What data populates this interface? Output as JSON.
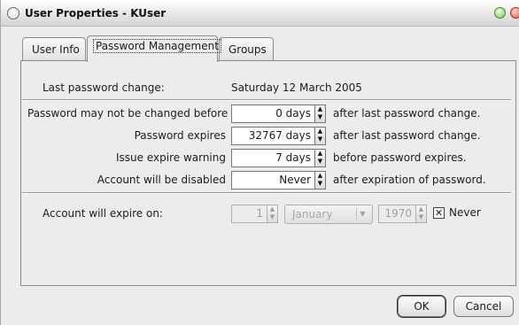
{
  "window": {
    "title": "User Properties - KUser"
  },
  "tabs": [
    {
      "label": "User Info",
      "active": false
    },
    {
      "label": "Password Management",
      "active": true
    },
    {
      "label": "Groups",
      "active": false
    }
  ],
  "last_change": {
    "label": "Last password change:",
    "value": "Saturday 12 March 2005"
  },
  "rows": [
    {
      "label": "Password may not be changed before",
      "value": "0 days",
      "suffix": "after last password change."
    },
    {
      "label": "Password expires",
      "value": "32767 days",
      "suffix": "after last password change."
    },
    {
      "label": "Issue expire warning",
      "value": "7 days",
      "suffix": "before password expires."
    },
    {
      "label": "Account will be disabled",
      "value": "Never",
      "suffix": "after expiration of password."
    }
  ],
  "account_expire": {
    "label": "Account will expire on:",
    "day": "1",
    "month": "January",
    "year": "1970",
    "never_label": "Never",
    "never_checked": true,
    "never_mark": "✕"
  },
  "buttons": {
    "ok": "OK",
    "cancel": "Cancel"
  },
  "colors": {
    "background": "#ececec",
    "field": "#ffffff",
    "disabled_text": "#a0a0a0"
  }
}
